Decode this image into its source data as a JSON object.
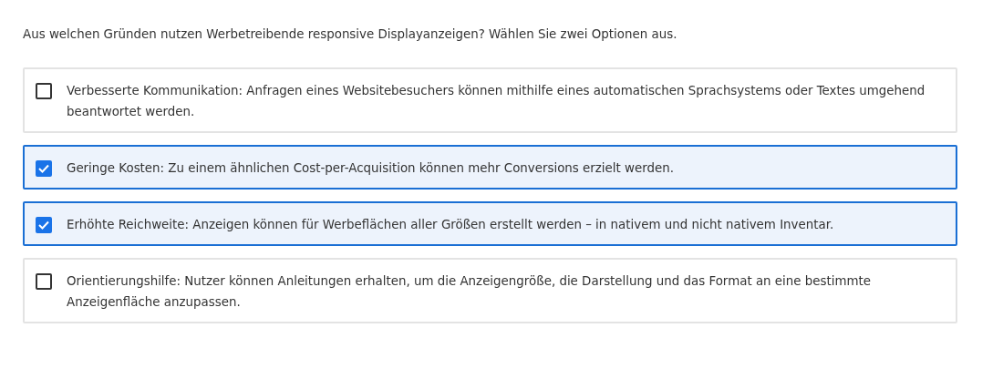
{
  "question": "Aus welchen Gründen nutzen Werbetreibende responsive Displayanzeigen? Wählen Sie zwei Optionen aus.",
  "options": [
    {
      "text": "Verbesserte Kommunikation: Anfragen eines Websitebesuchers können mithilfe eines automatischen Sprachsystems oder Textes umgehend beantwortet werden.",
      "checked": false
    },
    {
      "text": "Geringe Kosten: Zu einem ähnlichen Cost-per-Acquisition können mehr Conversions erzielt werden.",
      "checked": true
    },
    {
      "text": "Erhöhte Reichweite: Anzeigen können für Werbeflächen aller Größen erstellt werden – in nativem und nicht nativem Inventar.",
      "checked": true
    },
    {
      "text": "Orientierungshilfe: Nutzer können Anleitungen erhalten, um die Anzeigengröße, die Darstellung und das Format an eine bestimmte Anzeigenfläche anzupassen.",
      "checked": false
    }
  ]
}
